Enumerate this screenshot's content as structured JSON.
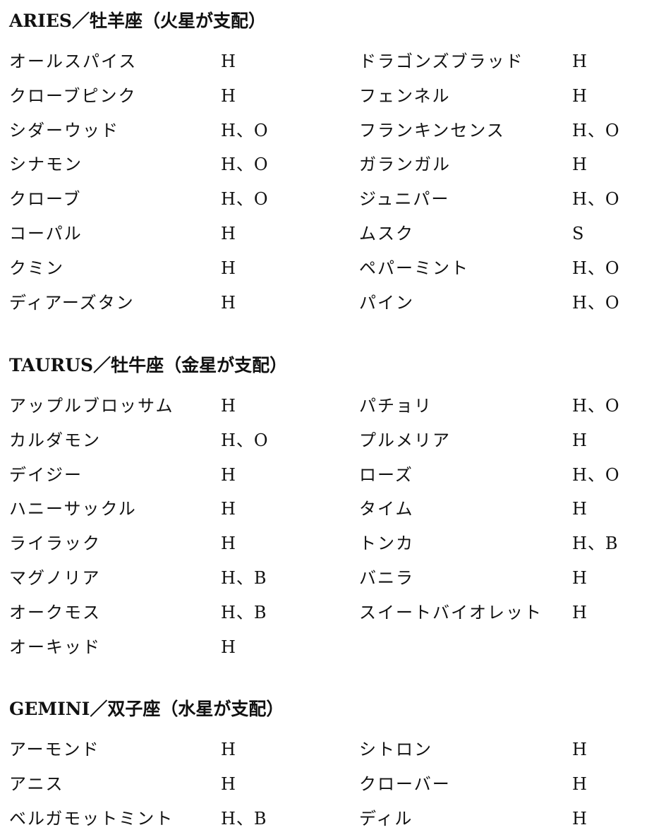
{
  "sections": [
    {
      "title": "ARIES／牡羊座（火星が支配）",
      "rows": [
        {
          "left": {
            "name": "オールスパイス",
            "code": "H"
          },
          "right": {
            "name": "ドラゴンズブラッド",
            "code": "H"
          }
        },
        {
          "left": {
            "name": "クローブピンク",
            "code": "H"
          },
          "right": {
            "name": "フェンネル",
            "code": "H"
          }
        },
        {
          "left": {
            "name": "シダーウッド",
            "code": "H、O"
          },
          "right": {
            "name": "フランキンセンス",
            "code": "H、O"
          }
        },
        {
          "left": {
            "name": "シナモン",
            "code": "H、O"
          },
          "right": {
            "name": "ガランガル",
            "code": "H"
          }
        },
        {
          "left": {
            "name": "クローブ",
            "code": "H、O"
          },
          "right": {
            "name": "ジュニパー",
            "code": "H、O"
          }
        },
        {
          "left": {
            "name": "コーパル",
            "code": "H"
          },
          "right": {
            "name": "ムスク",
            "code": "S"
          }
        },
        {
          "left": {
            "name": "クミン",
            "code": "H"
          },
          "right": {
            "name": "ペパーミント",
            "code": "H、O"
          }
        },
        {
          "left": {
            "name": "ディアーズタン",
            "code": "H"
          },
          "right": {
            "name": "パイン",
            "code": "H、O"
          }
        }
      ]
    },
    {
      "title": "TAURUS／牡牛座（金星が支配）",
      "rows": [
        {
          "left": {
            "name": "アップルブロッサム",
            "code": "H"
          },
          "right": {
            "name": "パチョリ",
            "code": "H、O"
          }
        },
        {
          "left": {
            "name": "カルダモン",
            "code": "H、O"
          },
          "right": {
            "name": "プルメリア",
            "code": "H"
          }
        },
        {
          "left": {
            "name": "デイジー",
            "code": "H"
          },
          "right": {
            "name": "ローズ",
            "code": "H、O"
          }
        },
        {
          "left": {
            "name": "ハニーサックル",
            "code": "H"
          },
          "right": {
            "name": "タイム",
            "code": "H"
          }
        },
        {
          "left": {
            "name": "ライラック",
            "code": "H"
          },
          "right": {
            "name": "トンカ",
            "code": "H、B"
          }
        },
        {
          "left": {
            "name": "マグノリア",
            "code": "H、B"
          },
          "right": {
            "name": "バニラ",
            "code": "H"
          }
        },
        {
          "left": {
            "name": "オークモス",
            "code": "H、B"
          },
          "right": {
            "name": "スイートバイオレット",
            "code": "H"
          }
        },
        {
          "left": {
            "name": "オーキッド",
            "code": "H"
          },
          "right": {
            "name": "",
            "code": ""
          }
        }
      ]
    },
    {
      "title": "GEMINI／双子座（水星が支配）",
      "rows": [
        {
          "left": {
            "name": "アーモンド",
            "code": "H"
          },
          "right": {
            "name": "シトロン",
            "code": "H"
          }
        },
        {
          "left": {
            "name": "アニス",
            "code": "H"
          },
          "right": {
            "name": "クローバー",
            "code": "H"
          }
        },
        {
          "left": {
            "name": "ベルガモットミント",
            "code": "H、B"
          },
          "right": {
            "name": "ディル",
            "code": "H"
          }
        }
      ]
    }
  ]
}
